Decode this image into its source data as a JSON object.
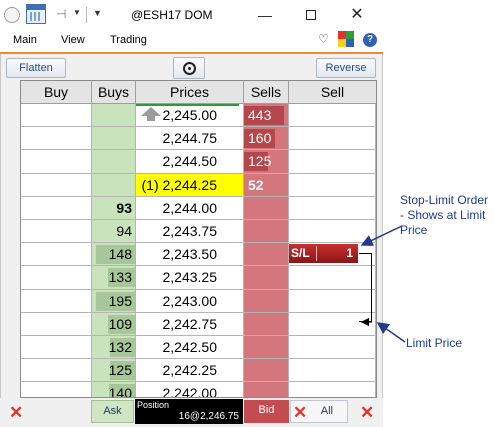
{
  "window": {
    "title": "@ESH17 DOM",
    "minimize_glyph": "—",
    "close_glyph": "✕"
  },
  "menu": {
    "main": "Main",
    "view": "View",
    "trading": "Trading"
  },
  "toolbar": {
    "flatten": "Flatten",
    "reverse": "Reverse"
  },
  "columns": {
    "buy": "Buy",
    "buys": "Buys",
    "prices": "Prices",
    "sells": "Sells",
    "sell": "Sell"
  },
  "rows": [
    {
      "price": "2,245.00",
      "buys": "",
      "sells": "443",
      "sells_fill": 0.92,
      "buys_fill": 0
    },
    {
      "price": "2,244.75",
      "buys": "",
      "sells": "160",
      "sells_fill": 0.7,
      "buys_fill": 0
    },
    {
      "price": "2,244.50",
      "buys": "",
      "sells": "125",
      "sells_fill": 0.55,
      "buys_fill": 0
    },
    {
      "price": "(1) 2,244.25",
      "buys": "",
      "sells": "52",
      "sells_fill": 0,
      "buys_fill": 0
    },
    {
      "price": "2,244.00",
      "buys": "93",
      "sells": "",
      "sells_fill": 0,
      "buys_fill": 0
    },
    {
      "price": "2,243.75",
      "buys": "94",
      "sells": "",
      "sells_fill": 0,
      "buys_fill": 0
    },
    {
      "price": "2,243.50",
      "buys": "148",
      "sells": "",
      "sells_fill": 0,
      "buys_fill": 0.9
    },
    {
      "price": "2,243.25",
      "buys": "133",
      "sells": "",
      "sells_fill": 0,
      "buys_fill": 0.62
    },
    {
      "price": "2,243.00",
      "buys": "195",
      "sells": "",
      "sells_fill": 0,
      "buys_fill": 0.9
    },
    {
      "price": "2,242.75",
      "buys": "109",
      "sells": "",
      "sells_fill": 0,
      "buys_fill": 0.62
    },
    {
      "price": "2,242.50",
      "buys": "132",
      "sells": "",
      "sells_fill": 0,
      "buys_fill": 0.58
    },
    {
      "price": "2,242.25",
      "buys": "125",
      "sells": "",
      "sells_fill": 0,
      "buys_fill": 0.58
    },
    {
      "price": "2,242.00",
      "buys": "140",
      "sells": "",
      "sells_fill": 0,
      "buys_fill": 0.6
    }
  ],
  "order": {
    "type": "S/L",
    "quantity": "1"
  },
  "bottom": {
    "ask": "Ask",
    "position_label": "Position",
    "position_value": "16@2,246.75",
    "bid": "Bid",
    "all": "All",
    "cancel_glyph": "✕"
  },
  "annotations": {
    "stop_limit": "Stop-Limit Order - Shows at Limit Price",
    "limit_price": "Limit Price"
  },
  "colors": {
    "accent": "#f08a2a",
    "buy_column": "#c9e4bd",
    "sell_column": "#d4777c",
    "last_price_highlight": "#ffff00",
    "annotation": "#1f3a8f"
  }
}
